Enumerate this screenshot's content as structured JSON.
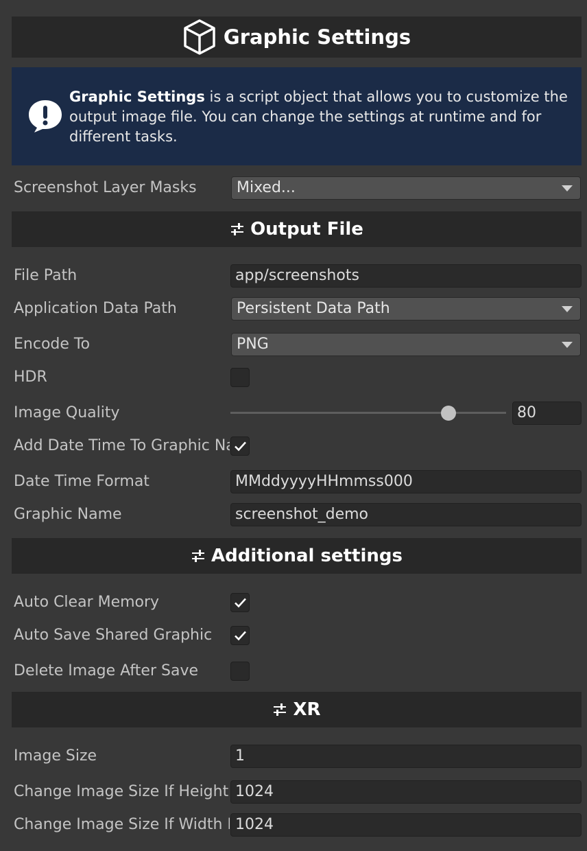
{
  "header": {
    "title": "Graphic Settings",
    "icon": "cube-icon"
  },
  "info": {
    "icon": "warning-bubble-icon",
    "bold_text": "Graphic Settings",
    "text": " is a script object that allows you to customize the output image file. You can change the settings at runtime and for different tasks."
  },
  "layer_masks": {
    "label": "Screenshot Layer Masks",
    "value": "Mixed..."
  },
  "output_file": {
    "title": "Output File",
    "icon": "sliders-icon",
    "file_path": {
      "label": "File Path",
      "value": "app/screenshots"
    },
    "app_data_path": {
      "label": "Application Data Path",
      "value": "Persistent Data Path"
    },
    "encode_to": {
      "label": "Encode To",
      "value": "PNG"
    },
    "hdr": {
      "label": "HDR",
      "checked": false
    },
    "image_quality": {
      "label": "Image Quality",
      "value": "80",
      "slider_fraction": 0.79
    },
    "add_date_time": {
      "label": "Add Date Time To Graphic Name",
      "checked": true
    },
    "date_time_format": {
      "label": "Date Time Format",
      "value": "MMddyyyyHHmmss000"
    },
    "graphic_name": {
      "label": "Graphic Name",
      "value": "screenshot_demo"
    }
  },
  "additional": {
    "title": "Additional settings",
    "icon": "sliders-icon",
    "auto_clear_memory": {
      "label": "Auto Clear Memory",
      "checked": true
    },
    "auto_save_shared": {
      "label": "Auto Save Shared Graphic",
      "checked": true
    },
    "delete_after_save": {
      "label": "Delete Image After Save",
      "checked": false
    }
  },
  "xr": {
    "title": "XR",
    "icon": "sliders-icon",
    "image_size": {
      "label": "Image Size",
      "value": "1"
    },
    "change_if_height": {
      "label": "Change Image Size If Height Is Greater Than",
      "value": "1024"
    },
    "change_if_width": {
      "label": "Change Image Size If Width Is Greater Than",
      "value": "1024"
    }
  },
  "colors": {
    "background": "#383838",
    "header_bar": "#282828",
    "info_background": "#1b2b47"
  }
}
